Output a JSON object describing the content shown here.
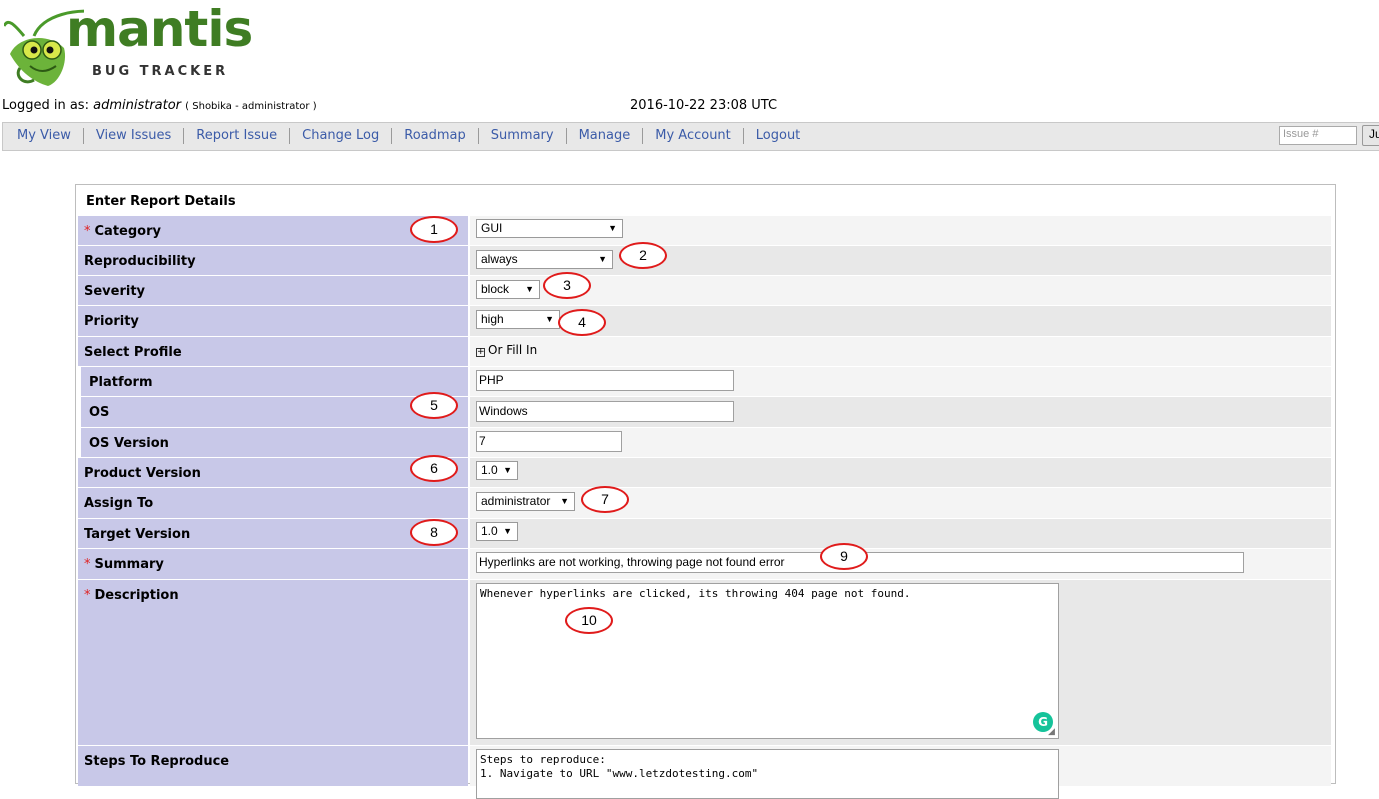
{
  "logo": {
    "word": "mantis",
    "subtitle": "BUG TRACKER"
  },
  "login": {
    "prefix": "Logged in as:",
    "username": "administrator",
    "detail": "( Shobika - administrator )",
    "datetime": "2016-10-22 23:08 UTC"
  },
  "menu": {
    "items": [
      {
        "label": "My View"
      },
      {
        "label": "View Issues"
      },
      {
        "label": "Report Issue"
      },
      {
        "label": "Change Log"
      },
      {
        "label": "Roadmap"
      },
      {
        "label": "Summary"
      },
      {
        "label": "Manage"
      },
      {
        "label": "My Account"
      },
      {
        "label": "Logout"
      }
    ],
    "issue_placeholder": "Issue #",
    "jump_label": "Ju"
  },
  "form": {
    "title": "Enter Report Details",
    "required_mark": "*",
    "category": {
      "label": "Category",
      "value": "GUI"
    },
    "reproducibility": {
      "label": "Reproducibility",
      "value": "always"
    },
    "severity": {
      "label": "Severity",
      "value": "block"
    },
    "priority": {
      "label": "Priority",
      "value": "high"
    },
    "select_profile": {
      "label": "Select Profile",
      "fill_in": "Or Fill In"
    },
    "platform": {
      "label": "Platform",
      "value": "PHP"
    },
    "os": {
      "label": "OS",
      "value": "Windows"
    },
    "os_version": {
      "label": "OS Version",
      "value": "7"
    },
    "product_version": {
      "label": "Product Version",
      "value": "1.0"
    },
    "assign_to": {
      "label": "Assign To",
      "value": "administrator"
    },
    "target_version": {
      "label": "Target Version",
      "value": "1.0"
    },
    "summary": {
      "label": "Summary",
      "value": "Hyperlinks are not working, throwing page not found error"
    },
    "description": {
      "label": "Description",
      "value": "Whenever hyperlinks are clicked, its throwing 404 page not found."
    },
    "steps": {
      "label": "Steps To Reproduce",
      "value": "Steps to reproduce:\n1. Navigate to URL \"www.letzdotesting.com\""
    }
  },
  "markers": [
    "1",
    "2",
    "3",
    "4",
    "5",
    "6",
    "7",
    "8",
    "9",
    "10"
  ],
  "colors": {
    "label_bg": "#c8c8e8",
    "link": "#3b5ba8",
    "required": "#e02020",
    "marker": "#e01b1b"
  }
}
